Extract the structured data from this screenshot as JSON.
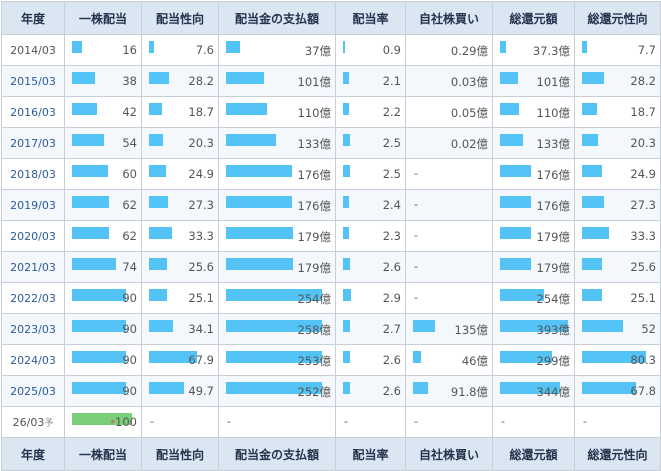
{
  "headers": [
    "年度",
    "一株配当",
    "配当性向",
    "配当金の支払額",
    "配当率",
    "自社株買い",
    "総還元額",
    "総還元性向"
  ],
  "rows": [
    {
      "year": "2014/03",
      "link": false,
      "c1": "16",
      "c2": "7.6",
      "c3": "37億",
      "c4": "0.9",
      "c5": "0.29億",
      "c6": "37.3億",
      "c7": "7.7"
    },
    {
      "year": "2015/03",
      "link": true,
      "c1": "38",
      "c2": "28.2",
      "c3": "101億",
      "c4": "2.1",
      "c5": "0.03億",
      "c6": "101億",
      "c7": "28.2"
    },
    {
      "year": "2016/03",
      "link": true,
      "c1": "42",
      "c2": "18.7",
      "c3": "110億",
      "c4": "2.2",
      "c5": "0.05億",
      "c6": "110億",
      "c7": "18.7"
    },
    {
      "year": "2017/03",
      "link": true,
      "c1": "54",
      "c2": "20.3",
      "c3": "133億",
      "c4": "2.5",
      "c5": "0.02億",
      "c6": "133億",
      "c7": "20.3"
    },
    {
      "year": "2018/03",
      "link": true,
      "c1": "60",
      "c2": "24.9",
      "c3": "176億",
      "c4": "2.5",
      "c5": "-",
      "c6": "176億",
      "c7": "24.9"
    },
    {
      "year": "2019/03",
      "link": true,
      "c1": "62",
      "c2": "27.3",
      "c3": "176億",
      "c4": "2.4",
      "c5": "-",
      "c6": "176億",
      "c7": "27.3"
    },
    {
      "year": "2020/03",
      "link": true,
      "c1": "62",
      "c2": "33.3",
      "c3": "179億",
      "c4": "2.3",
      "c5": "-",
      "c6": "179億",
      "c7": "33.3"
    },
    {
      "year": "2021/03",
      "link": true,
      "c1": "74",
      "c2": "25.6",
      "c3": "179億",
      "c4": "2.6",
      "c5": "-",
      "c6": "179億",
      "c7": "25.6"
    },
    {
      "year": "2022/03",
      "link": true,
      "c1": "90",
      "c2": "25.1",
      "c3": "254億",
      "c4": "2.9",
      "c5": "-",
      "c6": "254億",
      "c7": "25.1"
    },
    {
      "year": "2023/03",
      "link": true,
      "c1": "90",
      "c2": "34.1",
      "c3": "258億",
      "c4": "2.7",
      "c5": "135億",
      "c6": "393億",
      "c7": "52"
    },
    {
      "year": "2024/03",
      "link": true,
      "c1": "90",
      "c2": "67.9",
      "c3": "253億",
      "c4": "2.6",
      "c5": "46億",
      "c6": "299億",
      "c7": "80.3"
    },
    {
      "year": "2025/03",
      "link": true,
      "c1": "90",
      "c2": "49.7",
      "c3": "252億",
      "c4": "2.6",
      "c5": "91.8億",
      "c6": "344億",
      "c7": "67.8"
    }
  ],
  "forecast": {
    "year": "26/03",
    "suffix": "予",
    "marker": "*",
    "c1": "100",
    "dash": "-"
  },
  "bar_levels": {
    "c1": [
      0.16,
      0.38,
      0.42,
      0.54,
      0.6,
      0.62,
      0.62,
      0.74,
      0.9,
      0.9,
      0.9,
      0.9
    ],
    "c2": [
      0.09,
      0.33,
      0.22,
      0.24,
      0.29,
      0.32,
      0.39,
      0.3,
      0.3,
      0.4,
      0.8,
      0.58
    ],
    "c3": [
      0.15,
      0.4,
      0.43,
      0.52,
      0.69,
      0.69,
      0.7,
      0.7,
      1.0,
      1.0,
      1.0,
      1.0
    ],
    "c4": [
      0.15,
      0.35,
      0.37,
      0.42,
      0.42,
      0.4,
      0.38,
      0.43,
      0.48,
      0.45,
      0.43,
      0.43
    ],
    "c5": [
      0,
      0,
      0,
      0,
      0,
      0,
      0,
      0,
      0,
      0.4,
      0.14,
      0.27
    ],
    "c6": [
      0.09,
      0.26,
      0.28,
      0.34,
      0.45,
      0.45,
      0.46,
      0.46,
      0.65,
      1.0,
      0.76,
      0.88
    ],
    "c7": [
      0.08,
      0.33,
      0.22,
      0.24,
      0.29,
      0.32,
      0.39,
      0.3,
      0.3,
      0.61,
      0.94,
      0.8
    ],
    "forecast_c1": 1.0
  },
  "colors": {
    "bar": "#52c3f4",
    "forecast_bar": "#7ccf7a",
    "header_bg": "#dbe6f3"
  }
}
